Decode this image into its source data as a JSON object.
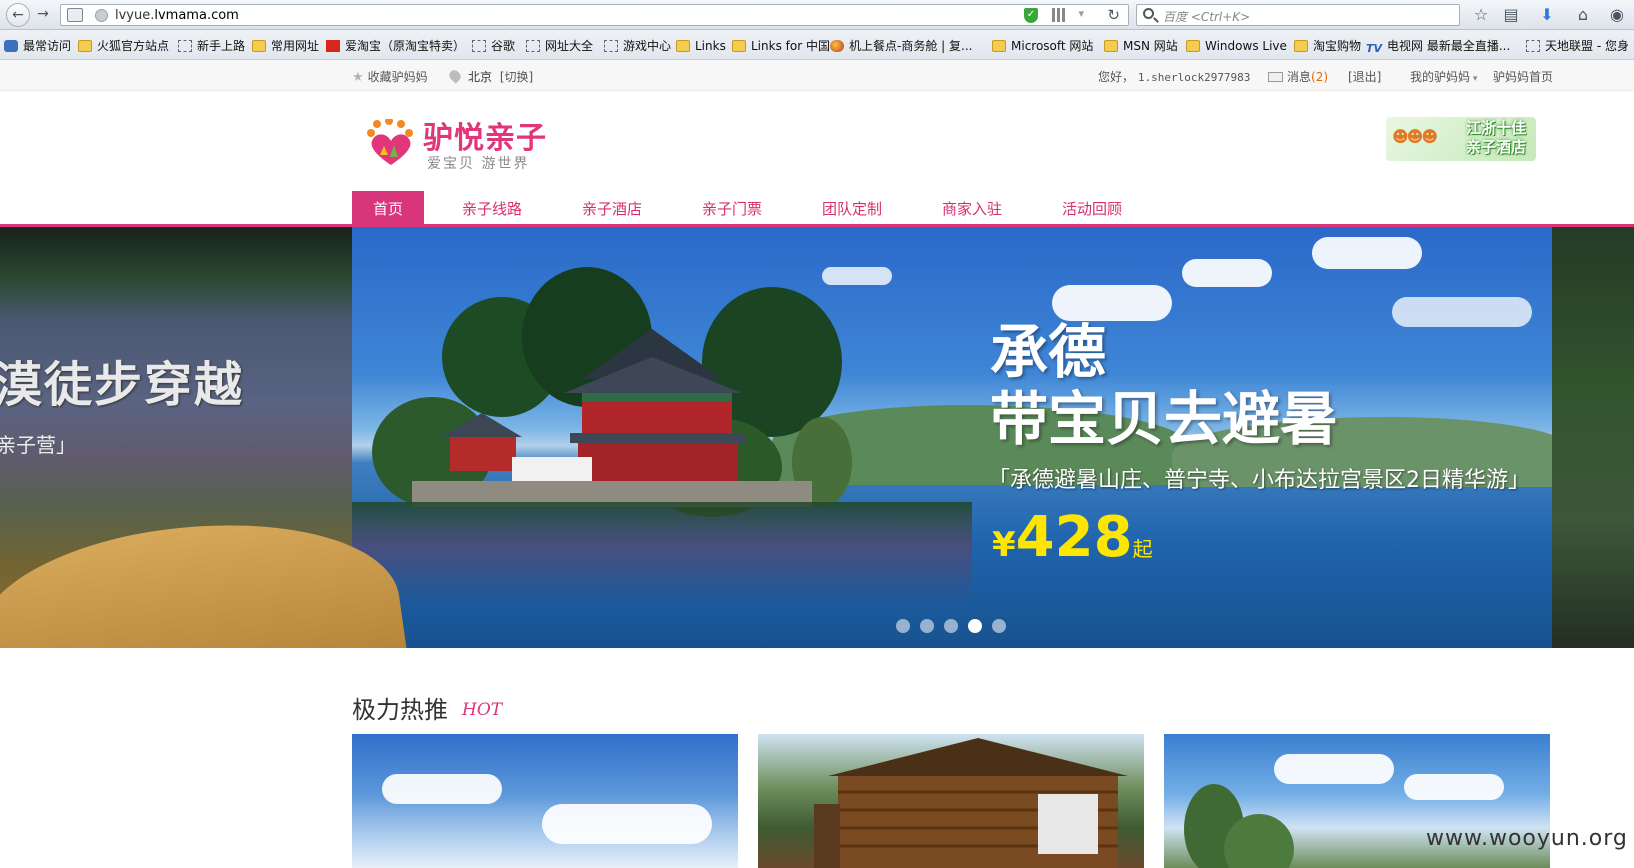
{
  "browser": {
    "url": {
      "prefix": "lvyue.",
      "domain": "lvmama.com"
    },
    "search_placeholder": "百度 <Ctrl+K>",
    "bookmarks": [
      {
        "label": "最常访问",
        "icon": "blue"
      },
      {
        "label": "火狐官方站点",
        "icon": "folder"
      },
      {
        "label": "新手上路",
        "icon": "dotted"
      },
      {
        "label": "常用网址",
        "icon": "folder"
      },
      {
        "label": "爱淘宝（原淘宝特卖）",
        "icon": "redbox"
      },
      {
        "label": "谷歌",
        "icon": "dotted"
      },
      {
        "label": "网址大全",
        "icon": "dotted"
      },
      {
        "label": "游戏中心",
        "icon": "dotted"
      },
      {
        "label": "Links",
        "icon": "folder"
      },
      {
        "label": "Links for 中国",
        "icon": "folder"
      },
      {
        "label": "机上餐点-商务舱 | 复...",
        "icon": "globe"
      },
      {
        "label": "Microsoft 网站",
        "icon": "folder"
      },
      {
        "label": "MSN 网站",
        "icon": "folder"
      },
      {
        "label": "Windows Live",
        "icon": "folder"
      },
      {
        "label": "淘宝购物",
        "icon": "folder"
      },
      {
        "label": "电视网 最新最全直播...",
        "icon": "tv"
      },
      {
        "label": "天地联盟 - 您身",
        "icon": "dotted"
      }
    ]
  },
  "site_top": {
    "favorite": "收藏驴妈妈",
    "city": "北京",
    "switch_city": "[切换]",
    "greeting": "您好，",
    "username": "1.sherlock2977983",
    "messages_label": "消息",
    "messages_count": "(2)",
    "logout": "[退出]",
    "my_account": "我的驴妈妈",
    "home_link": "驴妈妈首页"
  },
  "header": {
    "logo_text": "驴悦亲子",
    "slogan": "爱宝贝  游世界",
    "promo_line1": "江浙十佳",
    "promo_line2": "亲子酒店"
  },
  "nav": [
    {
      "label": "首页",
      "active": true
    },
    {
      "label": "亲子线路"
    },
    {
      "label": "亲子酒店"
    },
    {
      "label": "亲子门票"
    },
    {
      "label": "团队定制"
    },
    {
      "label": "商家入驻"
    },
    {
      "label": "活动回顾"
    }
  ],
  "banner": {
    "prev_title": "漠徒步穿越",
    "prev_sub": "亲子营」",
    "title_line1": "承德",
    "title_line2": "带宝贝去避暑",
    "desc": "「承德避暑山庄、普宁寺、小布达拉宫景区2日精华游」",
    "currency": "¥",
    "price": "428",
    "price_suffix": "起",
    "dots_total": 5,
    "active_dot": 4
  },
  "hot": {
    "title": "极力热推",
    "title_en": "HOT"
  },
  "watermark": "www.wooyun.org"
}
